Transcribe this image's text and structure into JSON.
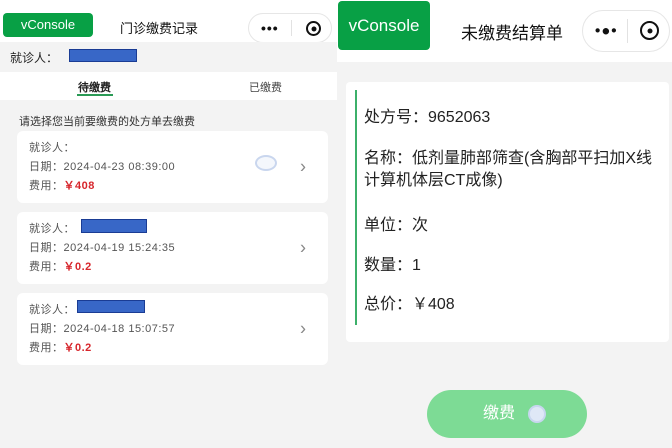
{
  "left_panel": {
    "vconsole_label": "vConsole",
    "title": "门诊缴费记录",
    "patient_label": "就诊人：",
    "tabs": [
      {
        "label": "待缴费",
        "active": true
      },
      {
        "label": "已缴费",
        "active": false
      }
    ],
    "hint": "请选择您当前要缴费的处方单去缴费",
    "cards": [
      {
        "patient_label": "就诊人：",
        "date_label": "日期：",
        "date": "2024-04-23 08:39:00",
        "fee_label": "费用：",
        "fee": "￥408"
      },
      {
        "patient_label": "就诊人：",
        "date_label": "日期：",
        "date": "2024-04-19 15:24:35",
        "fee_label": "费用：",
        "fee": "￥0.2"
      },
      {
        "patient_label": "就诊人：",
        "date_label": "日期：",
        "date": "2024-04-18 15:07:57",
        "fee_label": "费用：",
        "fee": "￥0.2"
      }
    ]
  },
  "right_panel": {
    "vconsole_label": "vConsole",
    "title": "未缴费结算单",
    "details": {
      "rx_no": "处方号：9652063",
      "name": "名称：低剂量肺部筛查(含胸部平扫加X线计算机体层CT成像)",
      "unit": "单位：次",
      "quantity": "数量：1",
      "total": "总价：￥408"
    },
    "pay_button": "缴费"
  },
  "colors": {
    "brand_green": "#08a045",
    "accent_green": "#2a9a55",
    "fee_red": "#d7262c",
    "pay_button": "#7ddb95",
    "redaction_blue": "#3867c7"
  },
  "icons": [
    "more-dots-icon",
    "target-icon",
    "chevron-right-icon",
    "loading-spinner-icon"
  ]
}
